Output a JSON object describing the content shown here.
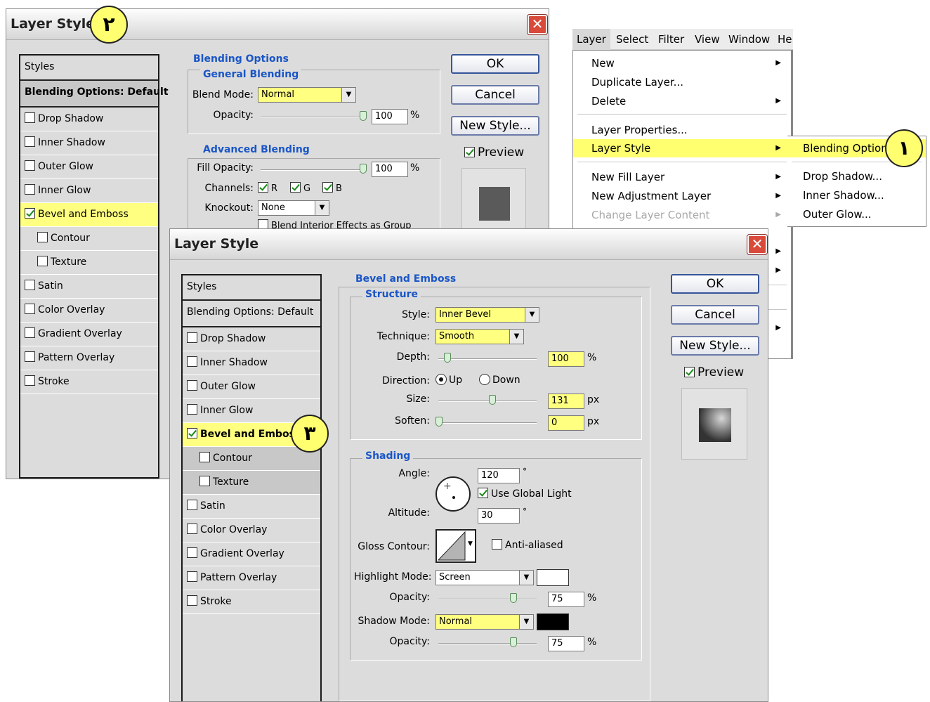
{
  "badges": {
    "one": "١",
    "two": "٢",
    "three": "٣"
  },
  "menubar": {
    "items": [
      "Layer",
      "Select",
      "Filter",
      "View",
      "Window",
      "He"
    ]
  },
  "layer_menu": {
    "items": [
      {
        "label": "New",
        "submenu": true,
        "disabled": false
      },
      {
        "label": "Duplicate Layer...",
        "submenu": false,
        "disabled": false
      },
      {
        "label": "Delete",
        "submenu": true,
        "disabled": false
      },
      {
        "label": "Layer Properties...",
        "submenu": false,
        "disabled": false
      },
      {
        "label": "Layer Style",
        "submenu": true,
        "disabled": false,
        "highlighted": true
      },
      {
        "label": "New Fill Layer",
        "submenu": true,
        "disabled": false
      },
      {
        "label": "New Adjustment Layer",
        "submenu": true,
        "disabled": false
      },
      {
        "label": "Change Layer Content",
        "submenu": true,
        "disabled": true
      }
    ]
  },
  "style_submenu": {
    "items": [
      "Blending Options",
      "Drop Shadow...",
      "Inner Shadow...",
      "Outer Glow..."
    ]
  },
  "dialog1": {
    "title": "Layer Style",
    "styles_header": "Styles",
    "blending_item": "Blending Options: Default",
    "items": [
      {
        "label": "Drop Shadow",
        "checked": false
      },
      {
        "label": "Inner Shadow",
        "checked": false
      },
      {
        "label": "Outer Glow",
        "checked": false
      },
      {
        "label": "Inner Glow",
        "checked": false
      },
      {
        "label": "Bevel and Emboss",
        "checked": true
      },
      {
        "label": "Contour",
        "checked": false
      },
      {
        "label": "Texture",
        "checked": false
      },
      {
        "label": "Satin",
        "checked": false
      },
      {
        "label": "Color Overlay",
        "checked": false
      },
      {
        "label": "Gradient Overlay",
        "checked": false
      },
      {
        "label": "Pattern Overlay",
        "checked": false
      },
      {
        "label": "Stroke",
        "checked": false
      }
    ],
    "blending_options_title": "Blending Options",
    "general_blending_title": "General Blending",
    "blend_mode_label": "Blend Mode:",
    "blend_mode_value": "Normal",
    "opacity_label": "Opacity:",
    "opacity_value": "100",
    "advanced_blending_title": "Advanced Blending",
    "fill_opacity_label": "Fill Opacity:",
    "fill_opacity_value": "100",
    "channels_label": "Channels:",
    "channels": [
      "R",
      "G",
      "B"
    ],
    "knockout_label": "Knockout:",
    "knockout_value": "None",
    "blend_interior_label": "Blend Interior Effects as Group",
    "percent": "%",
    "ok": "OK",
    "cancel": "Cancel",
    "new_style": "New Style...",
    "preview": "Preview"
  },
  "dialog2": {
    "title": "Layer Style",
    "styles_header": "Styles",
    "blending_item": "Blending Options: Default",
    "items": [
      {
        "label": "Drop Shadow",
        "checked": false
      },
      {
        "label": "Inner Shadow",
        "checked": false
      },
      {
        "label": "Outer Glow",
        "checked": false
      },
      {
        "label": "Inner Glow",
        "checked": false
      },
      {
        "label": "Bevel and Emboss",
        "checked": true
      },
      {
        "label": "Contour",
        "checked": false
      },
      {
        "label": "Texture",
        "checked": false
      },
      {
        "label": "Satin",
        "checked": false
      },
      {
        "label": "Color Overlay",
        "checked": false
      },
      {
        "label": "Gradient Overlay",
        "checked": false
      },
      {
        "label": "Pattern Overlay",
        "checked": false
      },
      {
        "label": "Stroke",
        "checked": false
      }
    ],
    "bevel_title": "Bevel and Emboss",
    "structure_title": "Structure",
    "style_label": "Style:",
    "style_value": "Inner Bevel",
    "technique_label": "Technique:",
    "technique_value": "Smooth",
    "depth_label": "Depth:",
    "depth_value": "100",
    "direction_label": "Direction:",
    "direction_up": "Up",
    "direction_down": "Down",
    "size_label": "Size:",
    "size_value": "131",
    "soften_label": "Soften:",
    "soften_value": "0",
    "px": "px",
    "percent": "%",
    "shading_title": "Shading",
    "angle_label": "Angle:",
    "angle_value": "120",
    "degree": "°",
    "use_global_light": "Use Global Light",
    "altitude_label": "Altitude:",
    "altitude_value": "30",
    "gloss_contour_label": "Gloss Contour:",
    "anti_aliased": "Anti-aliased",
    "highlight_mode_label": "Highlight Mode:",
    "highlight_mode_value": "Screen",
    "highlight_opacity_label": "Opacity:",
    "highlight_opacity_value": "75",
    "shadow_mode_label": "Shadow Mode:",
    "shadow_mode_value": "Normal",
    "shadow_opacity_label": "Opacity:",
    "shadow_opacity_value": "75",
    "ok": "OK",
    "cancel": "Cancel",
    "new_style": "New Style...",
    "preview": "Preview"
  }
}
